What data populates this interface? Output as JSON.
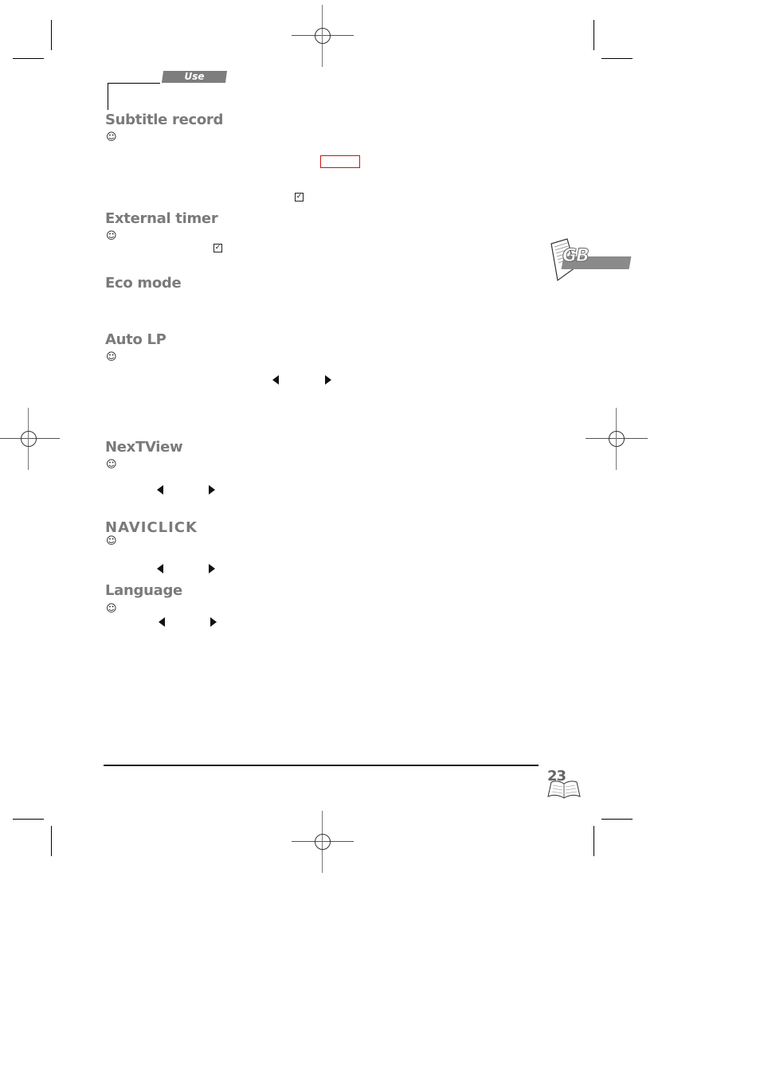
{
  "header": {
    "section_tab": "Use"
  },
  "language_badge": "GB",
  "sections": [
    {
      "title": "Subtitle record",
      "has_smiley": true
    },
    {
      "title": "External timer",
      "has_smiley": true
    },
    {
      "title": "Eco mode",
      "has_smiley": false
    },
    {
      "title": "Auto LP",
      "has_smiley": true
    },
    {
      "title": "NexTView",
      "has_smiley": true
    },
    {
      "title": "NAVICLICK",
      "has_smiley": true
    },
    {
      "title": "Language",
      "has_smiley": true
    }
  ],
  "icons": {
    "smiley": "☺",
    "checkbox_checked": "✓"
  },
  "footer": {
    "page_number": "23"
  },
  "colors": {
    "heading": "#7a7a7a",
    "tab_bg": "#7d7d7d",
    "highlight_box": "#d01010"
  }
}
